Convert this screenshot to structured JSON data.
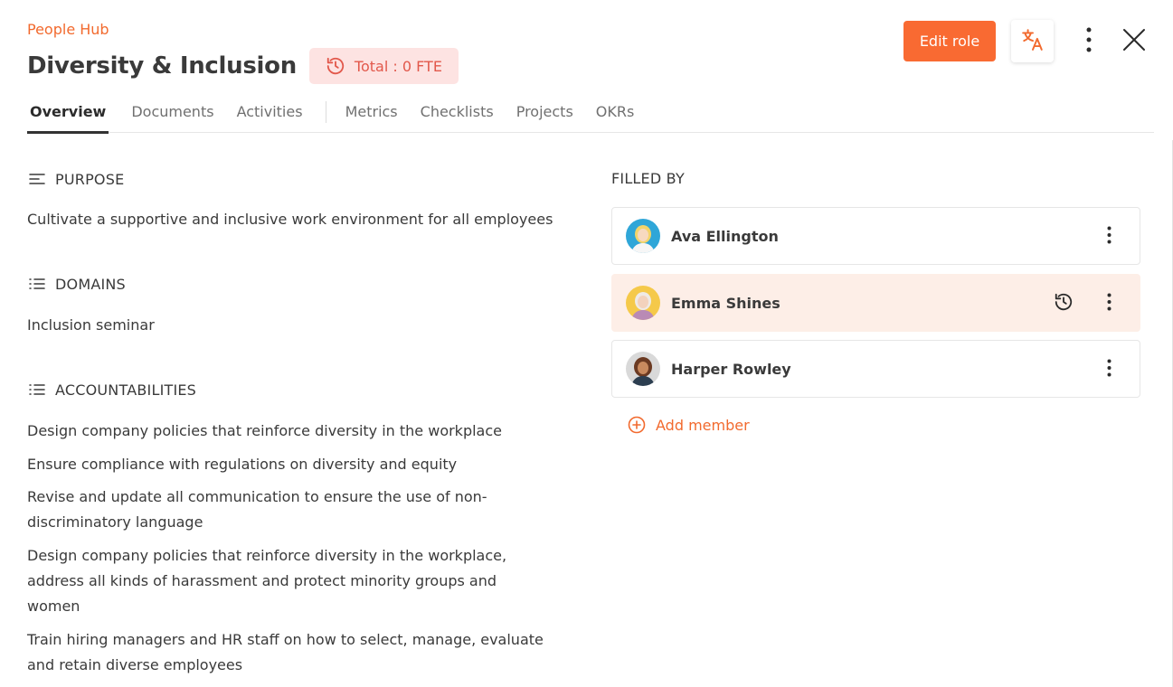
{
  "header": {
    "breadcrumb": "People Hub",
    "title": "Diversity & Inclusion",
    "fte_badge": "Total : 0 FTE",
    "edit_role_label": "Edit role"
  },
  "icons": {
    "fte": "history-icon",
    "translate": "translate-icon",
    "more": "more-vertical-icon",
    "close": "close-icon",
    "purpose": "align-left-icon",
    "domains": "list-icon",
    "accountabilities": "list-icon",
    "history": "history-icon",
    "add": "plus-circle-icon"
  },
  "tabs": [
    {
      "label": "Overview",
      "active": true
    },
    {
      "label": "Documents"
    },
    {
      "label": "Activities"
    },
    {
      "label": "Metrics"
    },
    {
      "label": "Checklists"
    },
    {
      "label": "Projects"
    },
    {
      "label": "OKRs"
    }
  ],
  "purpose": {
    "heading": "PURPOSE",
    "text": "Cultivate a supportive and inclusive work environment for all employees"
  },
  "domains": {
    "heading": "DOMAINS",
    "items": [
      "Inclusion seminar"
    ]
  },
  "accountabilities": {
    "heading": "ACCOUNTABILITIES",
    "items": [
      "Design company policies that reinforce diversity in the workplace",
      "Ensure compliance with regulations on diversity and equity",
      "Revise and update all communication to ensure the use of non-discriminatory language",
      "Design company policies that reinforce diversity in the workplace, address all kinds of harassment and protect minority groups and women",
      "Train hiring managers and HR staff on how to select, manage, evaluate and retain diverse employees"
    ]
  },
  "filled_by": {
    "heading": "FILLED BY",
    "members": [
      {
        "name": "Ava Ellington"
      },
      {
        "name": "Emma Shines"
      },
      {
        "name": "Harper Rowley"
      }
    ],
    "add_label": "Add member"
  },
  "colors": {
    "accent": "#f96a32",
    "badge_bg": "#fde3e2",
    "badge_text": "#e2584b",
    "highlight_bg": "#fdeee7"
  }
}
